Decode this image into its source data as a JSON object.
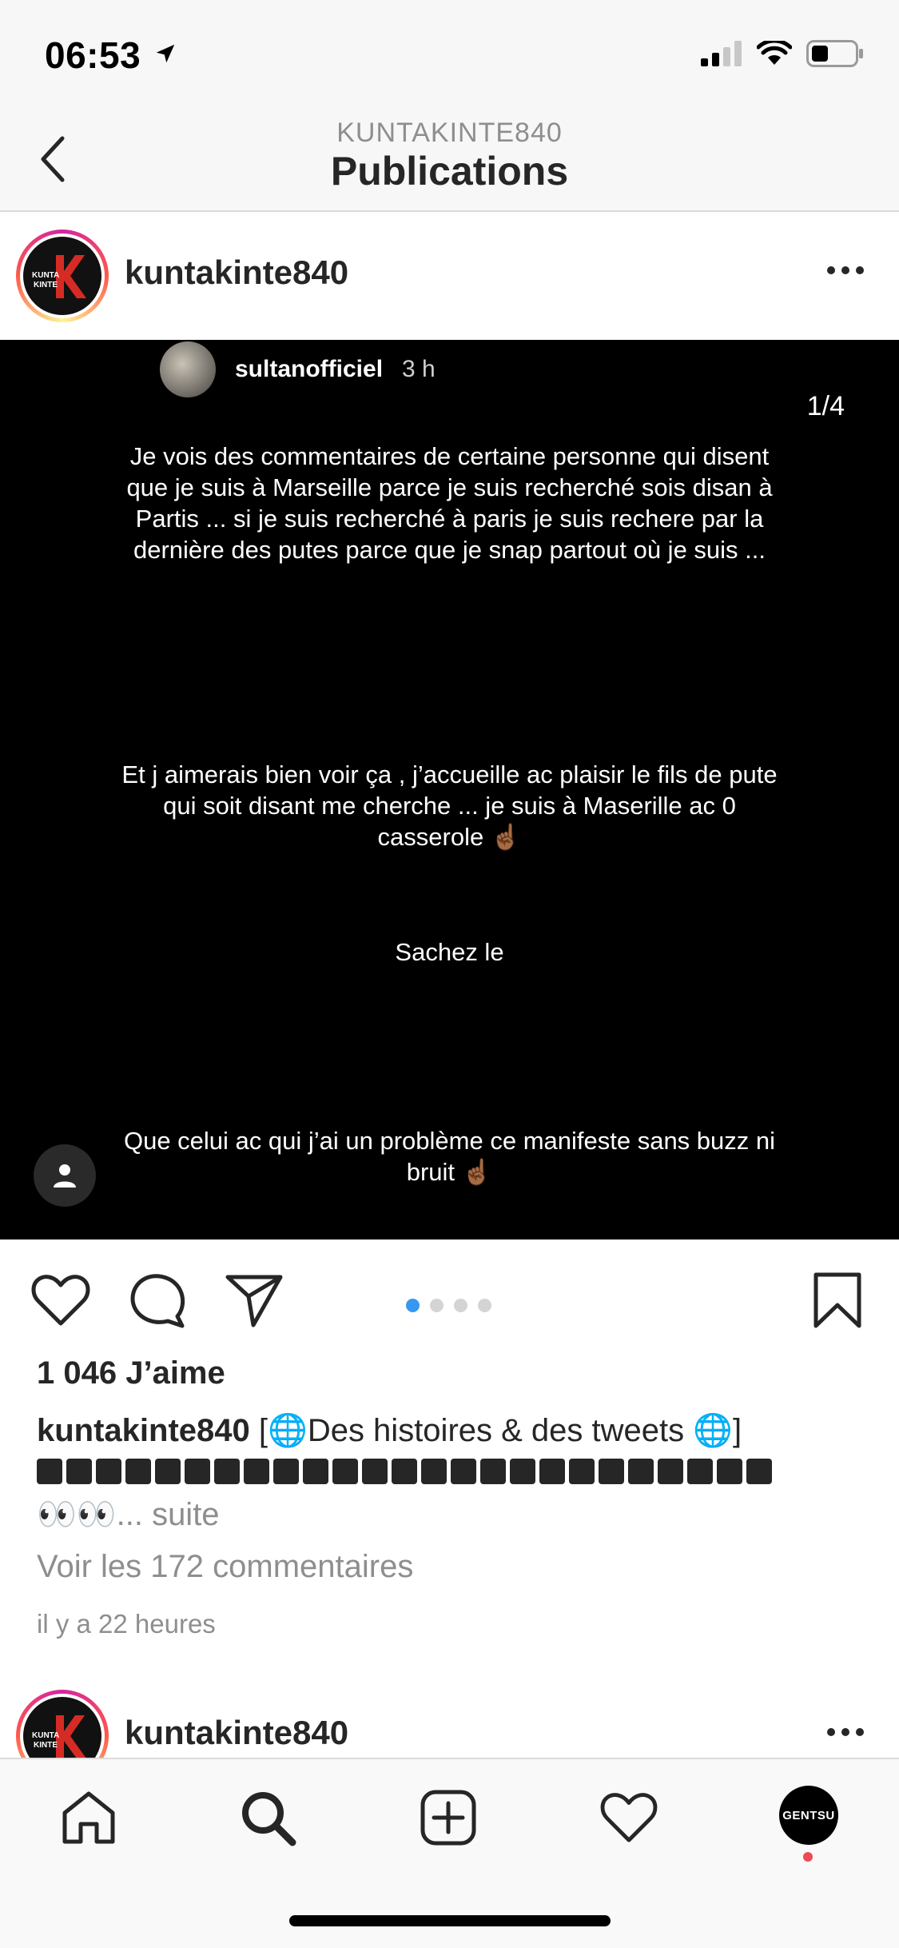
{
  "status_bar": {
    "time": "06:53"
  },
  "header": {
    "subtitle": "KUNTAKINTE840",
    "title": "Publications"
  },
  "post": {
    "username": "kuntakinte840",
    "avatar_text": "KUNTA KINTE",
    "story": {
      "username": "sultanofficiel",
      "time": "3 h",
      "counter": "1/4",
      "paragraph_1": "Je vois des commentaires de certaine personne qui disent que je suis à Marseille parce je suis recherché sois disan à Partis ...  si je suis recherché à paris je suis rechere par la dernière des putes parce que je snap partout où je suis  ...",
      "paragraph_2": "Et j aimerais bien voir ça , j’accueille ac plaisir le fils de pute qui soit disant me cherche ... je suis à Maserille ac 0 casserole ☝🏾",
      "paragraph_3": "Sachez le",
      "paragraph_4": "Que celui ac qui j’ai un problème ce manifeste sans buzz ni bruit ☝🏾"
    },
    "carousel": {
      "total": 4,
      "active_index": 0
    },
    "likes": "1 046 J’aime",
    "caption_user": "kuntakinte840",
    "caption_text": " [🌐Des histoires & des tweets 🌐]",
    "caption_eyes": "👀👀",
    "caption_more": "... suite",
    "view_comments": "Voir les 172 commentaires",
    "timestamp": "il y a 22 heures"
  },
  "next_post": {
    "username": "kuntakinte840"
  },
  "tab_bar": {
    "profile_label": "GENTSU"
  },
  "colors": {
    "accent_blue": "#3897f0",
    "notification_red": "#ed4956",
    "text_primary": "#262626",
    "text_secondary": "#8e8e8e"
  },
  "icons": {
    "status": [
      "location-arrow-icon",
      "signal-icon",
      "wifi-icon",
      "battery-icon"
    ],
    "nav": [
      "back-chevron-icon"
    ],
    "actions": [
      "heart-icon",
      "comment-icon",
      "send-icon",
      "bookmark-icon"
    ],
    "tabs": [
      "home-icon",
      "search-icon",
      "add-icon",
      "heart-icon",
      "profile-avatar"
    ]
  }
}
